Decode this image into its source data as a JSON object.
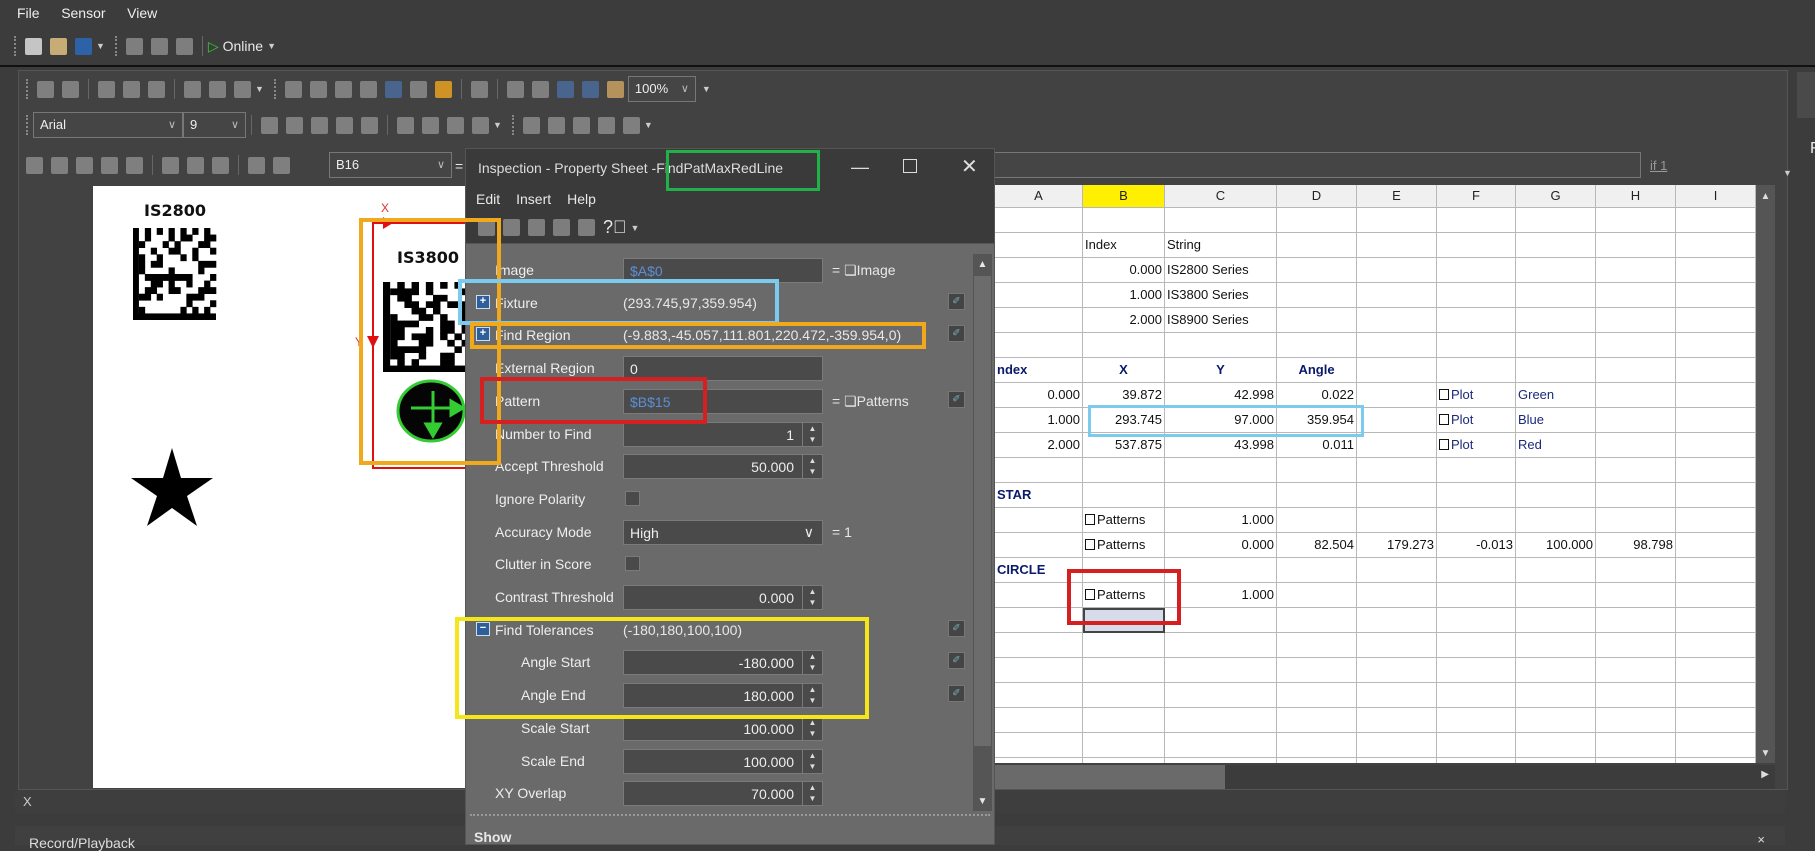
{
  "menubar": {
    "items": [
      "File",
      "Sensor",
      "View"
    ]
  },
  "toolbar1": {
    "online_label": "Online"
  },
  "toolbar2": {
    "zoom": "100%"
  },
  "toolbar3": {
    "font": "Arial",
    "size": "9"
  },
  "formula_bar": {
    "cell_ref": "B16",
    "equals": "=",
    "formula": "",
    "if_link": "if 1"
  },
  "image_view": {
    "labels": [
      "IS2800",
      "IS3800"
    ],
    "axis_x": "X",
    "axis_y": "Y"
  },
  "status": {
    "text": "X"
  },
  "bottom_panel": {
    "title": "Record/Playback",
    "close": "×"
  },
  "right_panel": {
    "letter": "F"
  },
  "property_sheet": {
    "title_prefix": "Inspection - Property Sheet - ",
    "title_name": "FindPatMaxRedLine",
    "menu": [
      "Edit",
      "Insert",
      "Help"
    ],
    "rows": [
      {
        "label": "Image",
        "kind": "input",
        "value": "$A$0",
        "ref": true,
        "suffix": "= ❏Image"
      },
      {
        "label": "Fixture",
        "kind": "group",
        "expanded": false,
        "value": "(293.745,97,359.954)",
        "link": true
      },
      {
        "label": "Find Region",
        "kind": "group",
        "expanded": false,
        "value": "(-9.883,-45.057,111.801,220.472,-359.954,0)",
        "link": true
      },
      {
        "label": "External Region",
        "kind": "input",
        "value": "0"
      },
      {
        "label": "Pattern",
        "kind": "input",
        "value": "$B$15",
        "ref": true,
        "suffix": "= ❏Patterns",
        "link": true
      },
      {
        "label": "Number to Find",
        "kind": "spin",
        "value": "1"
      },
      {
        "label": "Accept Threshold",
        "kind": "spin",
        "value": "50.000"
      },
      {
        "label": "Ignore Polarity",
        "kind": "check",
        "checked": false
      },
      {
        "label": "Accuracy Mode",
        "kind": "select",
        "value": "High",
        "suffix": "= 1"
      },
      {
        "label": "Clutter in Score",
        "kind": "check",
        "checked": false
      },
      {
        "label": "Contrast Threshold",
        "kind": "spin",
        "value": "0.000"
      },
      {
        "label": "Find Tolerances",
        "kind": "group",
        "expanded": true,
        "value": "(-180,180,100,100)",
        "link": true
      },
      {
        "label": "Angle Start",
        "kind": "spin",
        "sub": true,
        "value": "-180.000",
        "link": true
      },
      {
        "label": "Angle End",
        "kind": "spin",
        "sub": true,
        "value": "180.000",
        "link": true
      },
      {
        "label": "Scale Start",
        "kind": "spin",
        "sub": true,
        "value": "100.000"
      },
      {
        "label": "Scale End",
        "kind": "spin",
        "sub": true,
        "value": "100.000"
      },
      {
        "label": "XY Overlap",
        "kind": "spin",
        "value": "70.000"
      }
    ],
    "show_label": "Show"
  },
  "sheet": {
    "columns": [
      "A",
      "B",
      "C",
      "D",
      "E",
      "F",
      "G",
      "H",
      "I"
    ],
    "selected_column": "B",
    "rows": [
      [
        "",
        "",
        "",
        "",
        "",
        "",
        "",
        "",
        ""
      ],
      [
        "",
        "Index",
        "String",
        "",
        "",
        "",
        "",
        "",
        ""
      ],
      [
        "",
        "0.000",
        "IS2800 Series",
        "",
        "",
        "",
        "",
        "",
        ""
      ],
      [
        "",
        "1.000",
        "IS3800 Series",
        "",
        "",
        "",
        "",
        "",
        ""
      ],
      [
        "",
        "2.000",
        "IS8900 Series",
        "",
        "",
        "",
        "",
        "",
        ""
      ],
      [
        "",
        "",
        "",
        "",
        "",
        "",
        "",
        "",
        ""
      ],
      [
        "ndex",
        "X",
        "Y",
        "Angle",
        "",
        "",
        "",
        "",
        ""
      ],
      [
        "0.000",
        "39.872",
        "42.998",
        "0.022",
        "",
        "Plot",
        "Green",
        "",
        ""
      ],
      [
        "1.000",
        "293.745",
        "97.000",
        "359.954",
        "",
        "Plot",
        "Blue",
        "",
        ""
      ],
      [
        "2.000",
        "537.875",
        "43.998",
        "0.011",
        "",
        "Plot",
        "Red",
        "",
        ""
      ],
      [
        "",
        "",
        "",
        "",
        "",
        "",
        "",
        "",
        ""
      ],
      [
        "STAR",
        "",
        "",
        "",
        "",
        "",
        "",
        "",
        ""
      ],
      [
        "",
        "Patterns",
        "1.000",
        "",
        "",
        "",
        "",
        "",
        ""
      ],
      [
        "",
        "Patterns",
        "0.000",
        "82.504",
        "179.273",
        "-0.013",
        "100.000",
        "98.798",
        ""
      ],
      [
        "CIRCLE",
        "",
        "",
        "",
        "",
        "",
        "",
        "",
        ""
      ],
      [
        "",
        "Patterns",
        "1.000",
        "",
        "",
        "",
        "",
        "",
        ""
      ],
      [
        "",
        "",
        "",
        "",
        "",
        "",
        "",
        "",
        ""
      ],
      [
        "",
        "",
        "",
        "",
        "",
        "",
        "",
        "",
        ""
      ],
      [
        "",
        "",
        "",
        "",
        "",
        "",
        "",
        "",
        ""
      ],
      [
        "",
        "",
        "",
        "",
        "",
        "",
        "",
        "",
        ""
      ],
      [
        "",
        "",
        "",
        "",
        "",
        "",
        "",
        "",
        ""
      ],
      [
        "",
        "",
        "",
        "",
        "",
        "",
        "",
        "",
        ""
      ],
      [
        "",
        "",
        "",
        "",
        "",
        "",
        "",
        "",
        ""
      ]
    ]
  },
  "annotation_colors": {
    "green": "#22b04a",
    "blue": "#7ccbef",
    "orange": "#f0a91c",
    "red": "#d42020",
    "yellow": "#f5e61a"
  }
}
